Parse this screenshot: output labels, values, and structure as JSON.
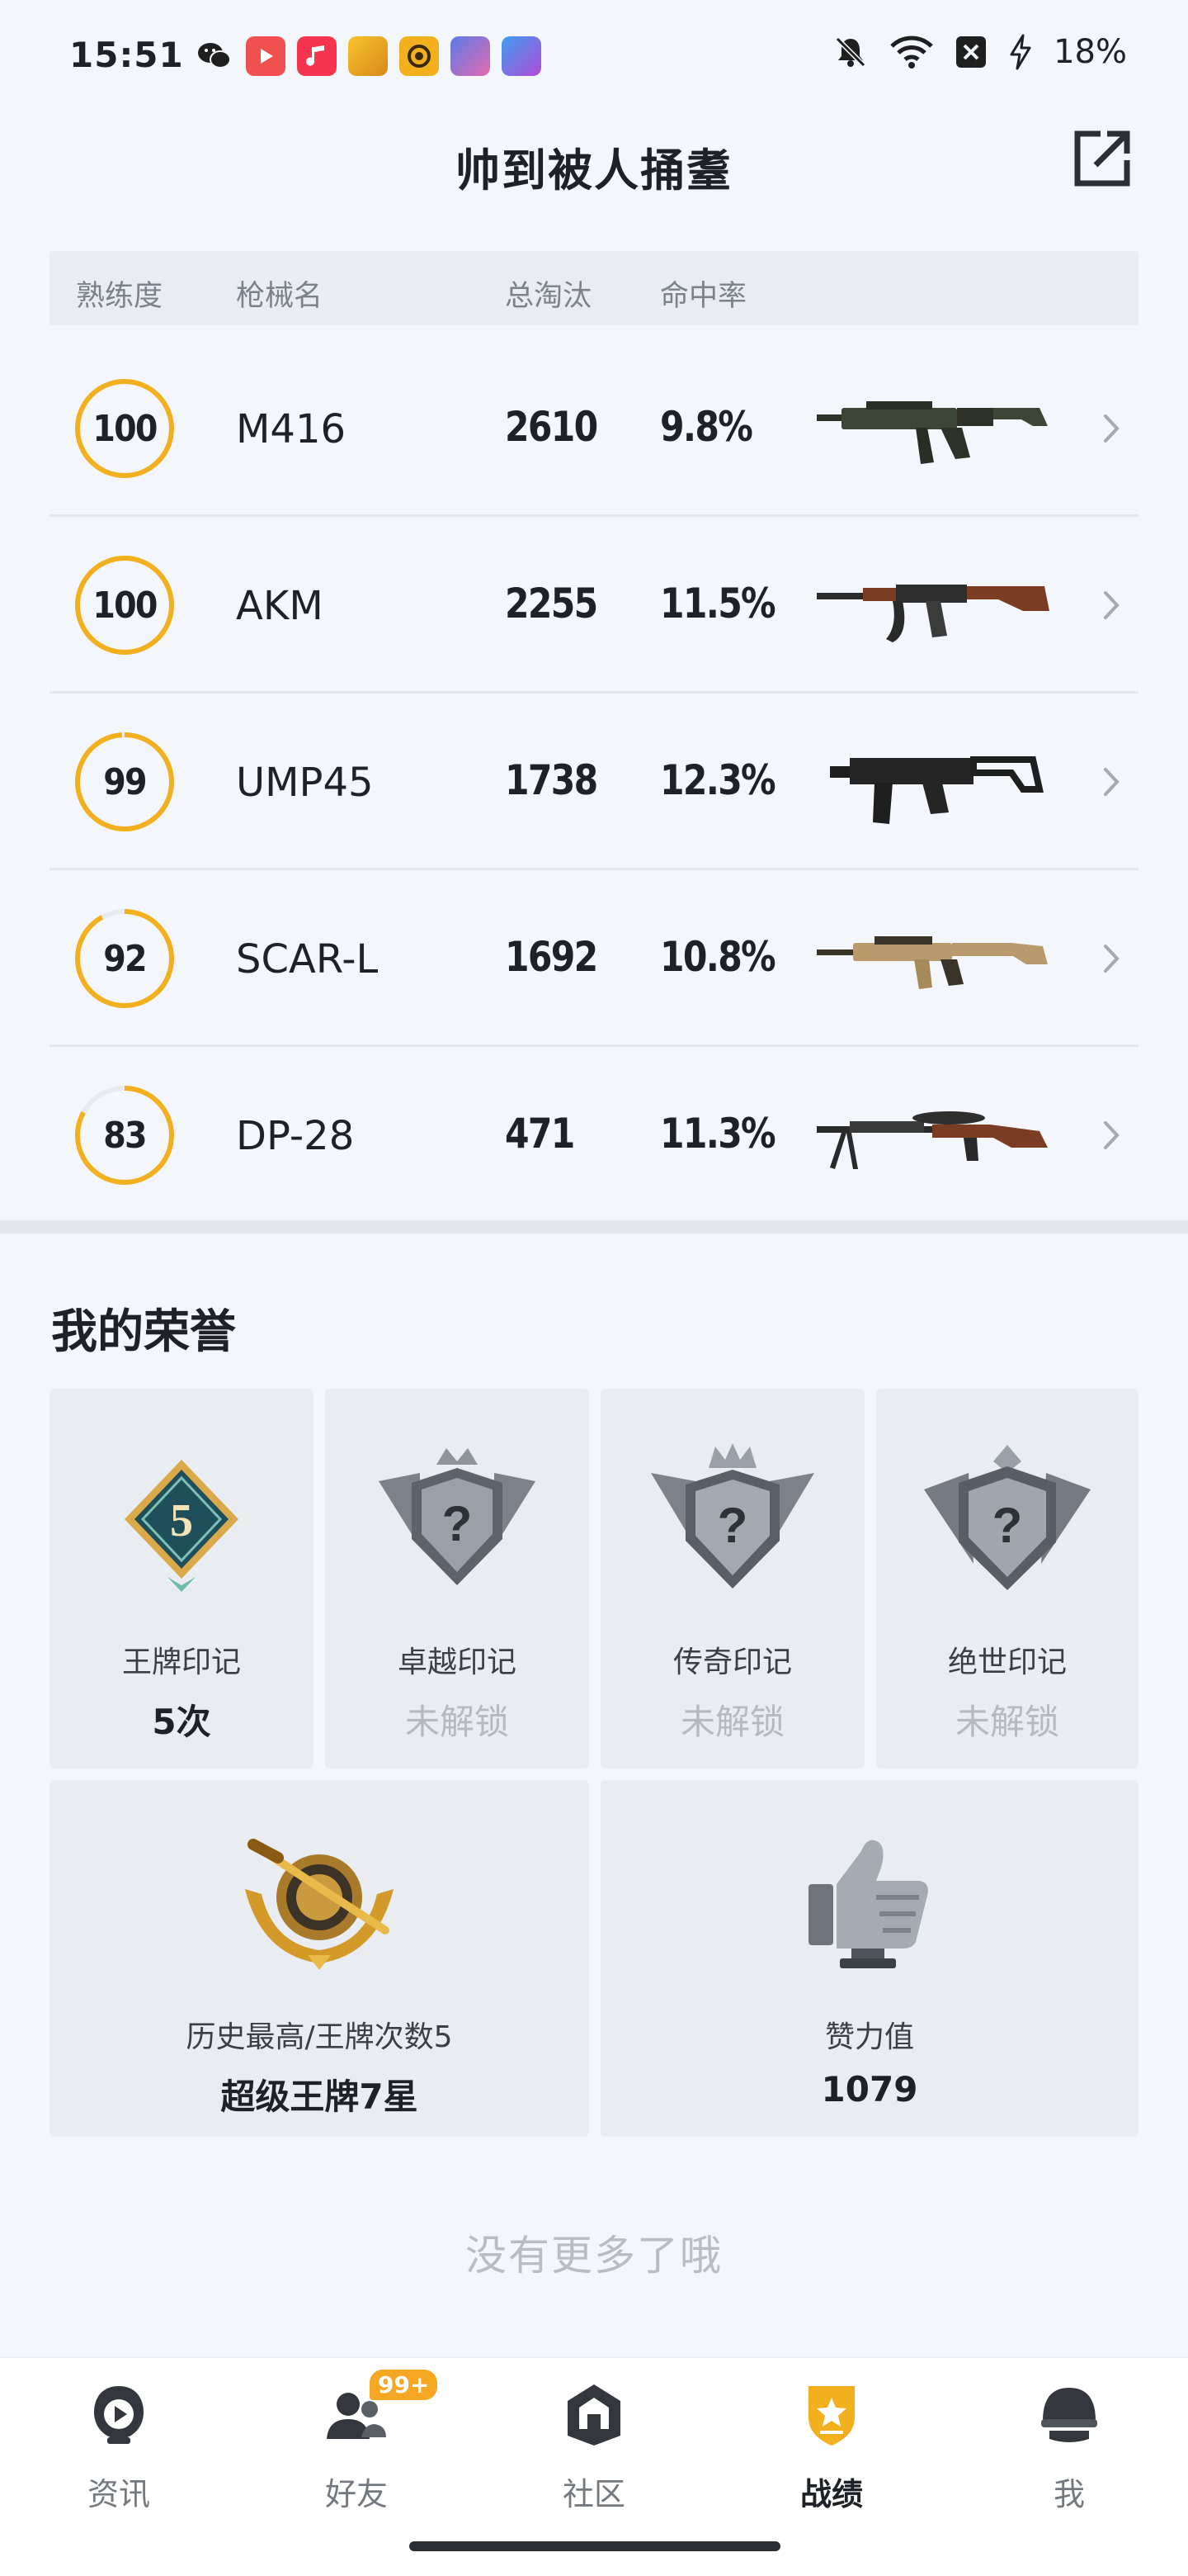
{
  "status_bar": {
    "time": "15:51",
    "battery": "18%",
    "notification_icons": [
      "wechat-icon",
      "video-app-icon",
      "music-app-icon",
      "game-app-icon",
      "game-app-icon",
      "game-app-icon",
      "game-app-icon"
    ],
    "status_icons": [
      "bell-muted-icon",
      "wifi-icon",
      "sim-off-icon",
      "charging-icon"
    ]
  },
  "header": {
    "title": "帅到被人捅耋",
    "share_icon": "share-external-icon"
  },
  "weapon_table": {
    "columns": {
      "proficiency": "熟练度",
      "name": "枪械名",
      "kills": "总淘汰",
      "accuracy": "命中率"
    },
    "rows": [
      {
        "proficiency": "100",
        "proficiency_level": 1.0,
        "name": "M416",
        "kills": "2610",
        "accuracy": "9.8%",
        "icon": "rifle-m416-icon"
      },
      {
        "proficiency": "100",
        "proficiency_level": 1.0,
        "name": "AKM",
        "kills": "2255",
        "accuracy": "11.5%",
        "icon": "rifle-akm-icon"
      },
      {
        "proficiency": "99",
        "proficiency_level": 0.99,
        "name": "UMP45",
        "kills": "1738",
        "accuracy": "12.3%",
        "icon": "smg-ump45-icon"
      },
      {
        "proficiency": "92",
        "proficiency_level": 0.92,
        "name": "SCAR-L",
        "kills": "1692",
        "accuracy": "10.8%",
        "icon": "rifle-scarl-icon"
      },
      {
        "proficiency": "83",
        "proficiency_level": 0.83,
        "name": "DP-28",
        "kills": "471",
        "accuracy": "11.3%",
        "icon": "lmg-dp28-icon"
      }
    ]
  },
  "honors": {
    "title": "我的荣誉",
    "marks": [
      {
        "label": "王牌印记",
        "value": "5次",
        "locked": false,
        "icon": "ace-mark-badge-icon",
        "badge_number": "5"
      },
      {
        "label": "卓越印记",
        "value": "未解锁",
        "locked": true,
        "icon": "excellence-mark-locked-icon"
      },
      {
        "label": "传奇印记",
        "value": "未解锁",
        "locked": true,
        "icon": "legend-mark-locked-icon"
      },
      {
        "label": "绝世印记",
        "value": "未解锁",
        "locked": true,
        "icon": "peerless-mark-locked-icon"
      }
    ],
    "stats": [
      {
        "label": "历史最高/王牌次数5",
        "value": "超级王牌7星",
        "icon": "super-ace-tier-emblem-icon"
      },
      {
        "label": "赞力值",
        "value": "1079",
        "icon": "thumbs-up-trophy-icon"
      }
    ]
  },
  "footer_message": "没有更多了哦",
  "bottom_nav": {
    "items": [
      {
        "label": "资讯",
        "icon": "news-play-icon",
        "active": false
      },
      {
        "label": "好友",
        "icon": "friends-icon",
        "active": false,
        "badge": "99+"
      },
      {
        "label": "社区",
        "icon": "community-icon",
        "active": false
      },
      {
        "label": "战绩",
        "icon": "record-badge-icon",
        "active": true
      },
      {
        "label": "我",
        "icon": "helmet-profile-icon",
        "active": false
      }
    ]
  },
  "colors": {
    "accent_gold": "#f2b01e",
    "ring_track": "#e8eaee",
    "locked_text": "#b5bac1",
    "background": "#f3f6fa",
    "card_background": "#e9edf2"
  }
}
